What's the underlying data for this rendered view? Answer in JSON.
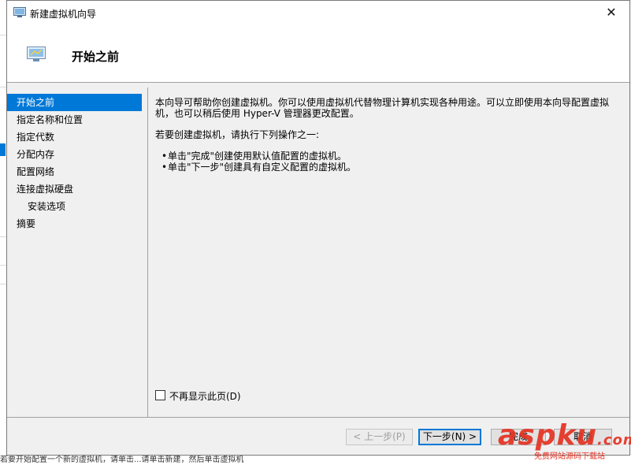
{
  "window": {
    "title": "新建虚拟机向导",
    "close_glyph": "✕",
    "icon": "hyper-v-vm-icon"
  },
  "header": {
    "title": "开始之前",
    "icon": "hyper-v-vm-icon"
  },
  "nav": {
    "items": [
      {
        "label": "开始之前",
        "active": true
      },
      {
        "label": "指定名称和位置"
      },
      {
        "label": "指定代数"
      },
      {
        "label": "分配内存"
      },
      {
        "label": "配置网络"
      },
      {
        "label": "连接虚拟硬盘"
      },
      {
        "label": "安装选项",
        "sub": true
      },
      {
        "label": "摘要"
      }
    ]
  },
  "content": {
    "intro": "本向导可帮助你创建虚拟机。你可以使用虚拟机代替物理计算机实现各种用途。可以立即使用本向导配置虚拟机，也可以稍后使用 Hyper-V 管理器更改配置。",
    "actions_intro": "若要创建虚拟机，请执行下列操作之一:",
    "options": [
      "单击\"完成\"创建使用默认值配置的虚拟机。",
      "单击\"下一步\"创建具有自定义配置的虚拟机。"
    ],
    "bullet": "•"
  },
  "checkbox": {
    "label": "不再显示此页(D)",
    "checked": false
  },
  "buttons": {
    "prev": "< 上一步(P)",
    "next": "下一步(N) >",
    "finish": "完成",
    "cancel": "取消"
  },
  "watermark": {
    "logo": "aspku",
    "logo_suffix": ".com",
    "subtitle": "免费网站源码下载站"
  },
  "background": {
    "status_text": "若要开始配置一个新的虚拟机，请单击...请单击新建，然后单击虚拟机"
  }
}
